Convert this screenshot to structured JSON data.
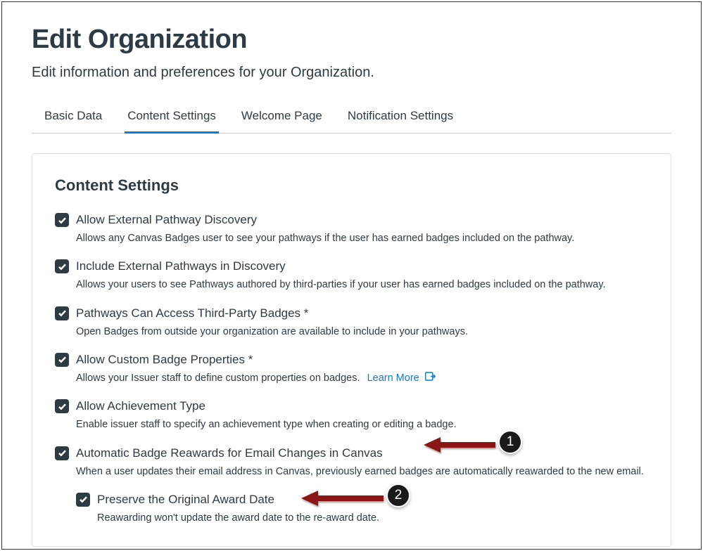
{
  "header": {
    "title": "Edit Organization",
    "subtitle": "Edit information and preferences for your Organization."
  },
  "tabs": [
    {
      "label": "Basic Data",
      "active": false
    },
    {
      "label": "Content Settings",
      "active": true
    },
    {
      "label": "Welcome Page",
      "active": false
    },
    {
      "label": "Notification Settings",
      "active": false
    }
  ],
  "panel": {
    "title": "Content Settings",
    "learn_more": "Learn More",
    "items": [
      {
        "label": "Allow External Pathway Discovery",
        "desc": "Allows any Canvas Badges user to see your pathways if the user has earned badges included on the pathway."
      },
      {
        "label": "Include External Pathways in Discovery",
        "desc": "Allows your users to see Pathways authored by third-parties if your user has earned badges included on the pathway."
      },
      {
        "label": "Pathways Can Access Third-Party Badges *",
        "desc": "Open Badges from outside your organization are available to include in your pathways."
      },
      {
        "label": "Allow Custom Badge Properties *",
        "desc": "Allows your Issuer staff to define custom properties on badges."
      },
      {
        "label": "Allow Achievement Type",
        "desc": "Enable issuer staff to specify an achievement type when creating or editing a badge."
      },
      {
        "label": "Automatic Badge Reawards for Email Changes in Canvas",
        "desc": "When a user updates their email address in Canvas, previously earned badges are automatically reawarded to the new email."
      },
      {
        "label": "Preserve the Original Award Date",
        "desc": "Reawarding won't update the award date to the re-award date."
      }
    ]
  },
  "callouts": {
    "c1": "1",
    "c2": "2"
  }
}
